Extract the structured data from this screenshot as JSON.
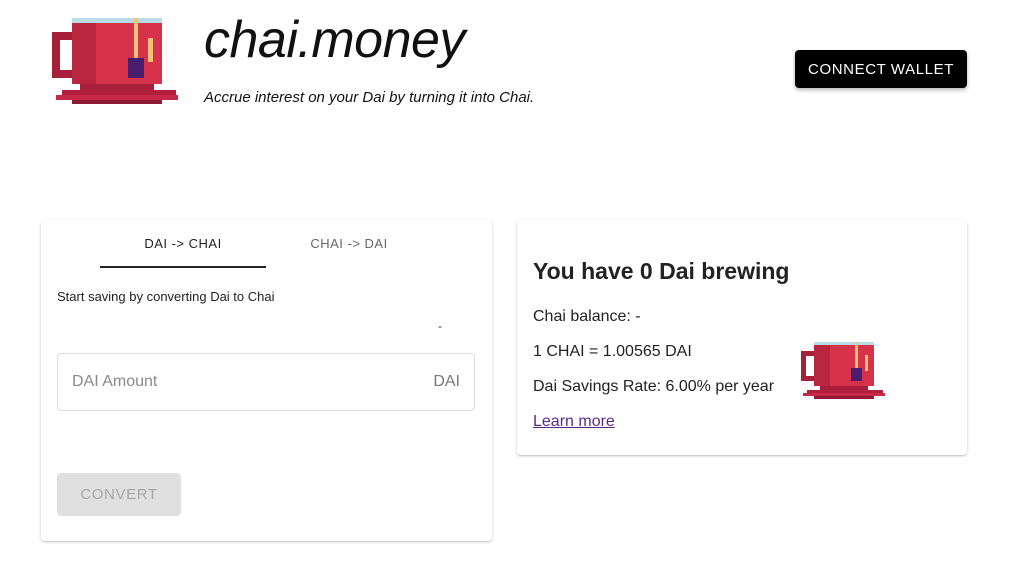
{
  "header": {
    "title": "chai.money",
    "tagline": "Accrue interest on your Dai by turning it into Chai.",
    "connect_label": "CONNECT WALLET",
    "logo_icon": "teacup-icon"
  },
  "converter": {
    "tabs": [
      {
        "label": "DAI -> CHAI",
        "active": true
      },
      {
        "label": "CHAI -> DAI",
        "active": false
      }
    ],
    "description": "Start saving by converting Dai to Chai",
    "balance": "-",
    "amount_placeholder": "DAI Amount",
    "amount_value": "",
    "amount_unit": "DAI",
    "convert_label": "CONVERT"
  },
  "summary": {
    "title": "You have 0 Dai brewing",
    "chai_balance": "Chai balance: -",
    "rate": "1 CHAI = 1.00565 DAI",
    "dsr": "Dai Savings Rate: 6.00% per year",
    "learn_more": "Learn more",
    "icon": "teacup-icon"
  },
  "colors": {
    "cup_red": "#d6324a",
    "cup_dark": "#a81f3a",
    "saucer": "#b0203c",
    "tea_bag": "#4a1d6e",
    "tag_string": "#f2c27a",
    "steam_rim": "#b8dde6",
    "link": "#5b2a86"
  }
}
